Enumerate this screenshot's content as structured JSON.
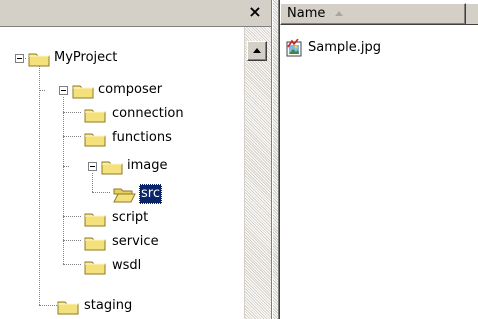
{
  "tree_pane": {
    "close_glyph": "×",
    "items": [
      {
        "label": "MyProject",
        "level": 0,
        "expanded": true,
        "selected": false,
        "open_folder": false
      },
      {
        "label": "composer",
        "level": 1,
        "expanded": true,
        "selected": false,
        "open_folder": false
      },
      {
        "label": "connection",
        "level": 2,
        "expanded": false,
        "selected": false,
        "open_folder": false
      },
      {
        "label": "functions",
        "level": 2,
        "expanded": false,
        "selected": false,
        "open_folder": false
      },
      {
        "label": "image",
        "level": 2,
        "expanded": true,
        "selected": false,
        "open_folder": false
      },
      {
        "label": "src",
        "level": 3,
        "expanded": false,
        "selected": true,
        "open_folder": true
      },
      {
        "label": "script",
        "level": 2,
        "expanded": false,
        "selected": false,
        "open_folder": false
      },
      {
        "label": "service",
        "level": 2,
        "expanded": false,
        "selected": false,
        "open_folder": false
      },
      {
        "label": "wsdl",
        "level": 2,
        "expanded": false,
        "selected": false,
        "open_folder": false
      },
      {
        "label": "staging",
        "level": 1,
        "expanded": false,
        "selected": false,
        "open_folder": false
      }
    ]
  },
  "list_pane": {
    "column_header": "Name",
    "sort_icon": "sort-ascending-icon",
    "files": [
      {
        "name": "Sample.jpg",
        "icon": "jpg-image-file-icon"
      }
    ]
  },
  "colors": {
    "selection": "#0a246a",
    "folder_fill": "#f5e17b",
    "folder_stroke": "#8c7a29",
    "chrome": "#d4d0c8"
  }
}
